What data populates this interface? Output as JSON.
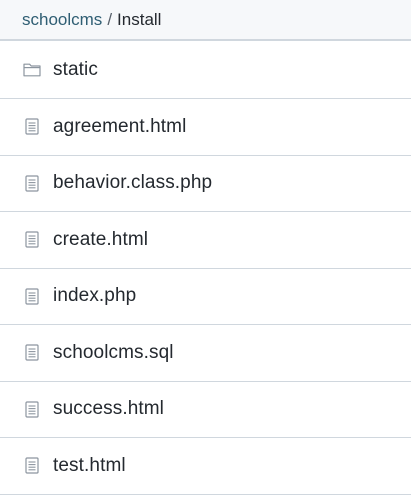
{
  "breadcrumb": {
    "repo": "schoolcms",
    "separator": "/",
    "current": "Install"
  },
  "files": [
    {
      "name": "static",
      "icon": "folder-icon"
    },
    {
      "name": "agreement.html",
      "icon": "file-icon"
    },
    {
      "name": "behavior.class.php",
      "icon": "file-icon"
    },
    {
      "name": "create.html",
      "icon": "file-icon"
    },
    {
      "name": "index.php",
      "icon": "file-icon"
    },
    {
      "name": "schoolcms.sql",
      "icon": "file-icon"
    },
    {
      "name": "success.html",
      "icon": "file-icon"
    },
    {
      "name": "test.html",
      "icon": "file-icon"
    }
  ],
  "colors": {
    "link": "#2f5e73",
    "border": "#d0d7de",
    "header_bg": "#f6f8fa",
    "icon": "#8c959f"
  }
}
